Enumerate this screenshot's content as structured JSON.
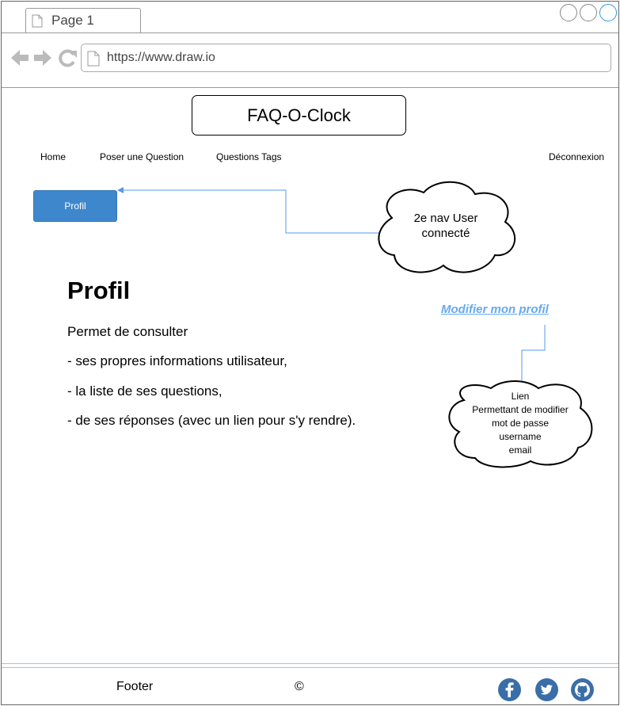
{
  "browser": {
    "tab_label": "Page 1",
    "url": "https://www.draw.io"
  },
  "page": {
    "brand": "FAQ-O-Clock",
    "nav": {
      "home": "Home",
      "ask": "Poser une Question",
      "tags": "Questions Tags",
      "logout": "Déconnexion"
    },
    "profile_button": "Profil",
    "heading": "Profil",
    "paragraphs": [
      "Permet de consulter",
      "- ses propres informations utilisateur,",
      "- la liste de ses questions,",
      "- de ses réponses (avec un lien pour s'y rendre)."
    ],
    "edit_link": "Modifier mon profil"
  },
  "annotations": {
    "cloud1": [
      "2e nav User",
      "connecté"
    ],
    "cloud2": [
      "Lien",
      "Permettant de modifier",
      "mot de passe",
      "username",
      "email"
    ]
  },
  "footer": {
    "label": "Footer",
    "copyright": "©",
    "social": [
      "facebook-icon",
      "twitter-icon",
      "github-icon"
    ]
  },
  "colors": {
    "primary_button": "#3e87cc",
    "link": "#66aaee",
    "connector": "#5599ee",
    "social": "#3a6ea8"
  }
}
